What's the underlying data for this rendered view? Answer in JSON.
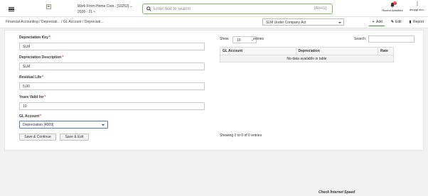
{
  "header": {
    "org_name": "Work From Home Com.. [10252]",
    "fiscal_year": "2020 - 21",
    "search": {
      "placeholder": "Enter text to search",
      "shortcut": "[Alt+G]"
    },
    "notifications": {
      "count": "0",
      "label": "Recent Activities"
    },
    "user": {
      "label": "anupgl.shn.."
    }
  },
  "breadcrumb": "Financial Accounting  / Depreciati... / GL Account / Depreciati...",
  "toolbar": {
    "depreciation_book": "SLM Under Company Act",
    "add_label": "Add",
    "edit_label": "Edit",
    "report_label": "Report"
  },
  "form": {
    "depreciation_key": {
      "label": "Depreciation Key",
      "value": "SLM"
    },
    "depreciation_description": {
      "label": "Depreciation Description",
      "value": "SLM"
    },
    "residual_life": {
      "label": "Residual Life",
      "value": "5.00"
    },
    "years_valid_for": {
      "label": "Years Valid for",
      "value": "10"
    },
    "gl_account": {
      "label": "GL Account",
      "value": "Depreciation [4009]"
    },
    "save_continue_label": "Save & Continue",
    "save_exit_label": "Save & Exit"
  },
  "table": {
    "show_label": "Show",
    "page_length": "10",
    "entries_label": "entries",
    "search_label": "Search:",
    "columns": [
      "GL Account",
      "Depreciation",
      "Rate"
    ],
    "empty_message": "No data available in table",
    "info": "Showing 0 to 0 of 0 entries"
  },
  "footer": {
    "link": "Check Internet Speed"
  },
  "colors": {
    "accent_green": "#3d8f35",
    "search_border": "#7cbd5b",
    "required": "#d9342b",
    "focus_blue": "#4a79c9"
  }
}
